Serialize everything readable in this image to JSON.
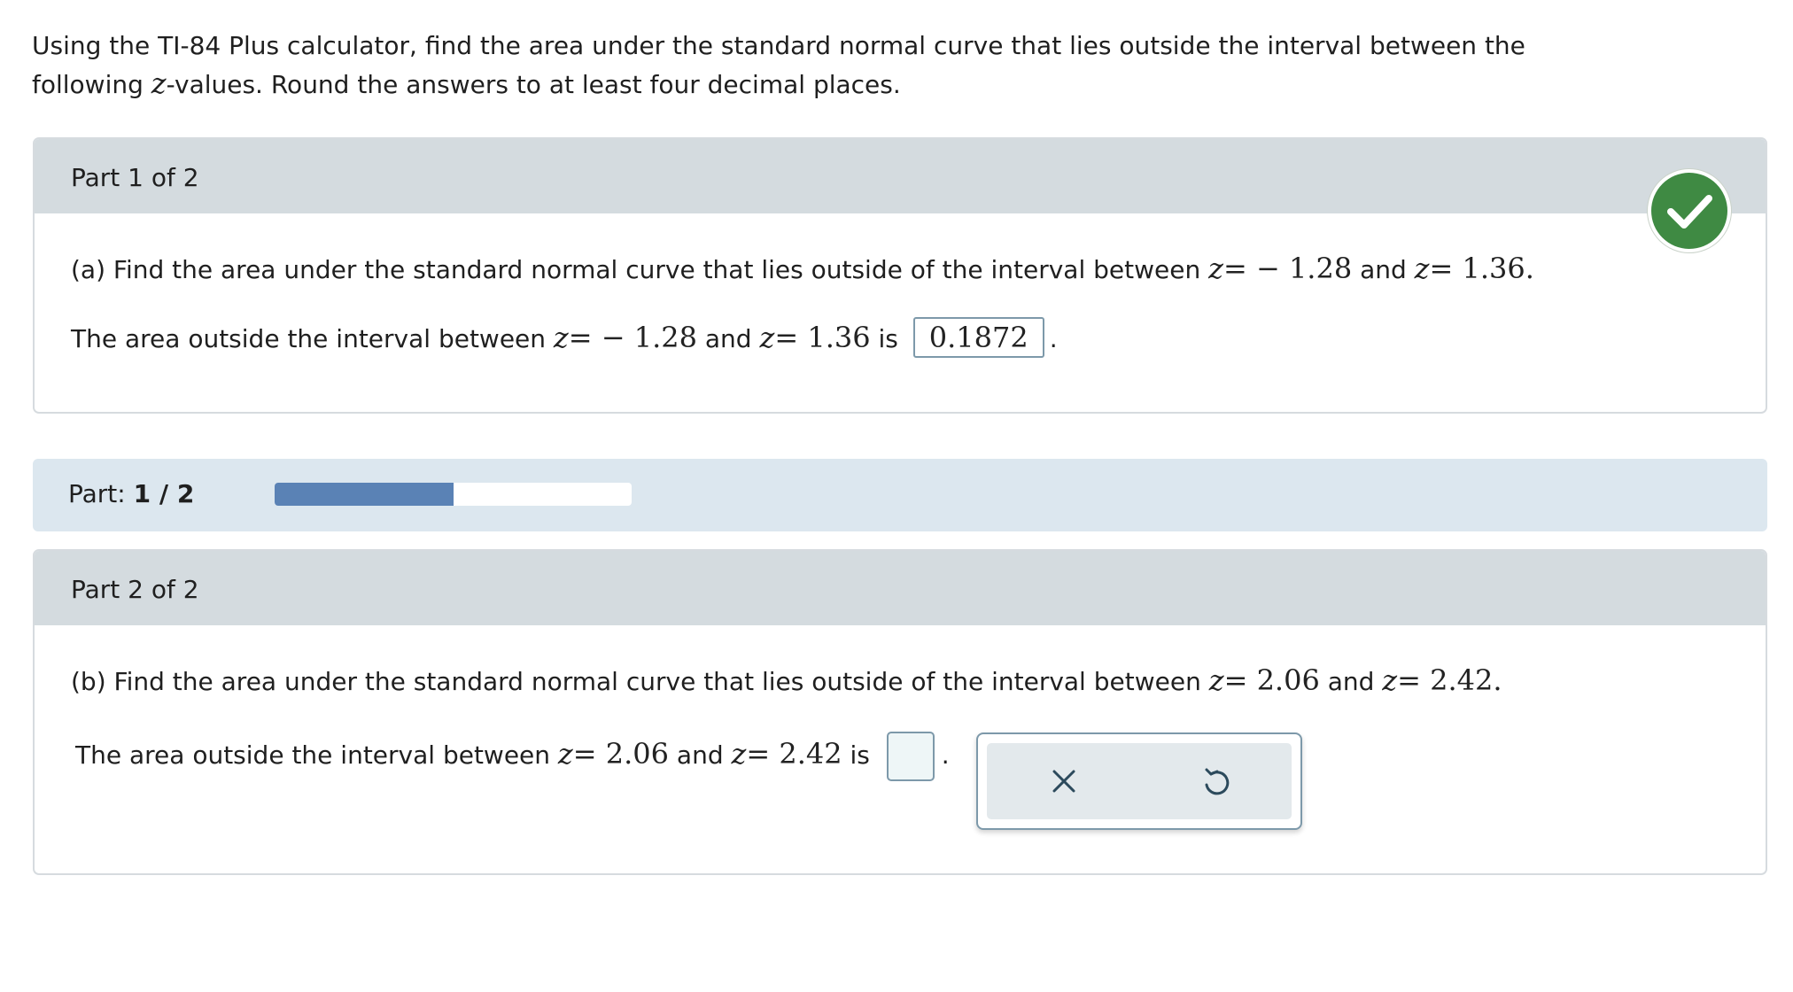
{
  "intro": {
    "line1": "Using the TI-84 Plus calculator, find the area under the standard normal curve that lies outside the interval between the",
    "line2_pre": "following ",
    "line2_var": "z",
    "line2_post": "-values. Round the answers to at least four decimal places."
  },
  "part1": {
    "title": "Part 1 of 2",
    "q_text": "(a) Find the area under the standard normal curve that lies outside of the interval between ",
    "q_z1_val": "= − 1.28",
    "q_and": " and ",
    "q_z2_val": "= 1.36",
    "q_end": ".",
    "a_text": "The area outside the interval between ",
    "a_z1_val": "= − 1.28",
    "a_and": " and ",
    "a_z2_val": "= 1.36",
    "a_is": " is ",
    "answer": "0.1872",
    "a_end": ".",
    "status_icon": "check-icon",
    "status_color": "#3f8a43"
  },
  "progress": {
    "label": "Part: ",
    "value": "1 / 2",
    "fraction": 0.5,
    "fill_color": "#5a82b5"
  },
  "part2": {
    "title": "Part 2 of 2",
    "q_text": "(b) Find the area under the standard normal curve that lies outside of the interval between ",
    "q_z1_val": "= 2.06",
    "q_and": " and ",
    "q_z2_val": "= 2.42",
    "q_end": ".",
    "a_text": "The area outside the interval between ",
    "a_z1_val": "= 2.06",
    "a_and": " and ",
    "a_z2_val": "= 2.42",
    "a_is": " is ",
    "answer": "",
    "a_end": "."
  },
  "tools": {
    "clear_icon": "close-icon",
    "undo_icon": "undo-icon"
  },
  "z_var": "z"
}
